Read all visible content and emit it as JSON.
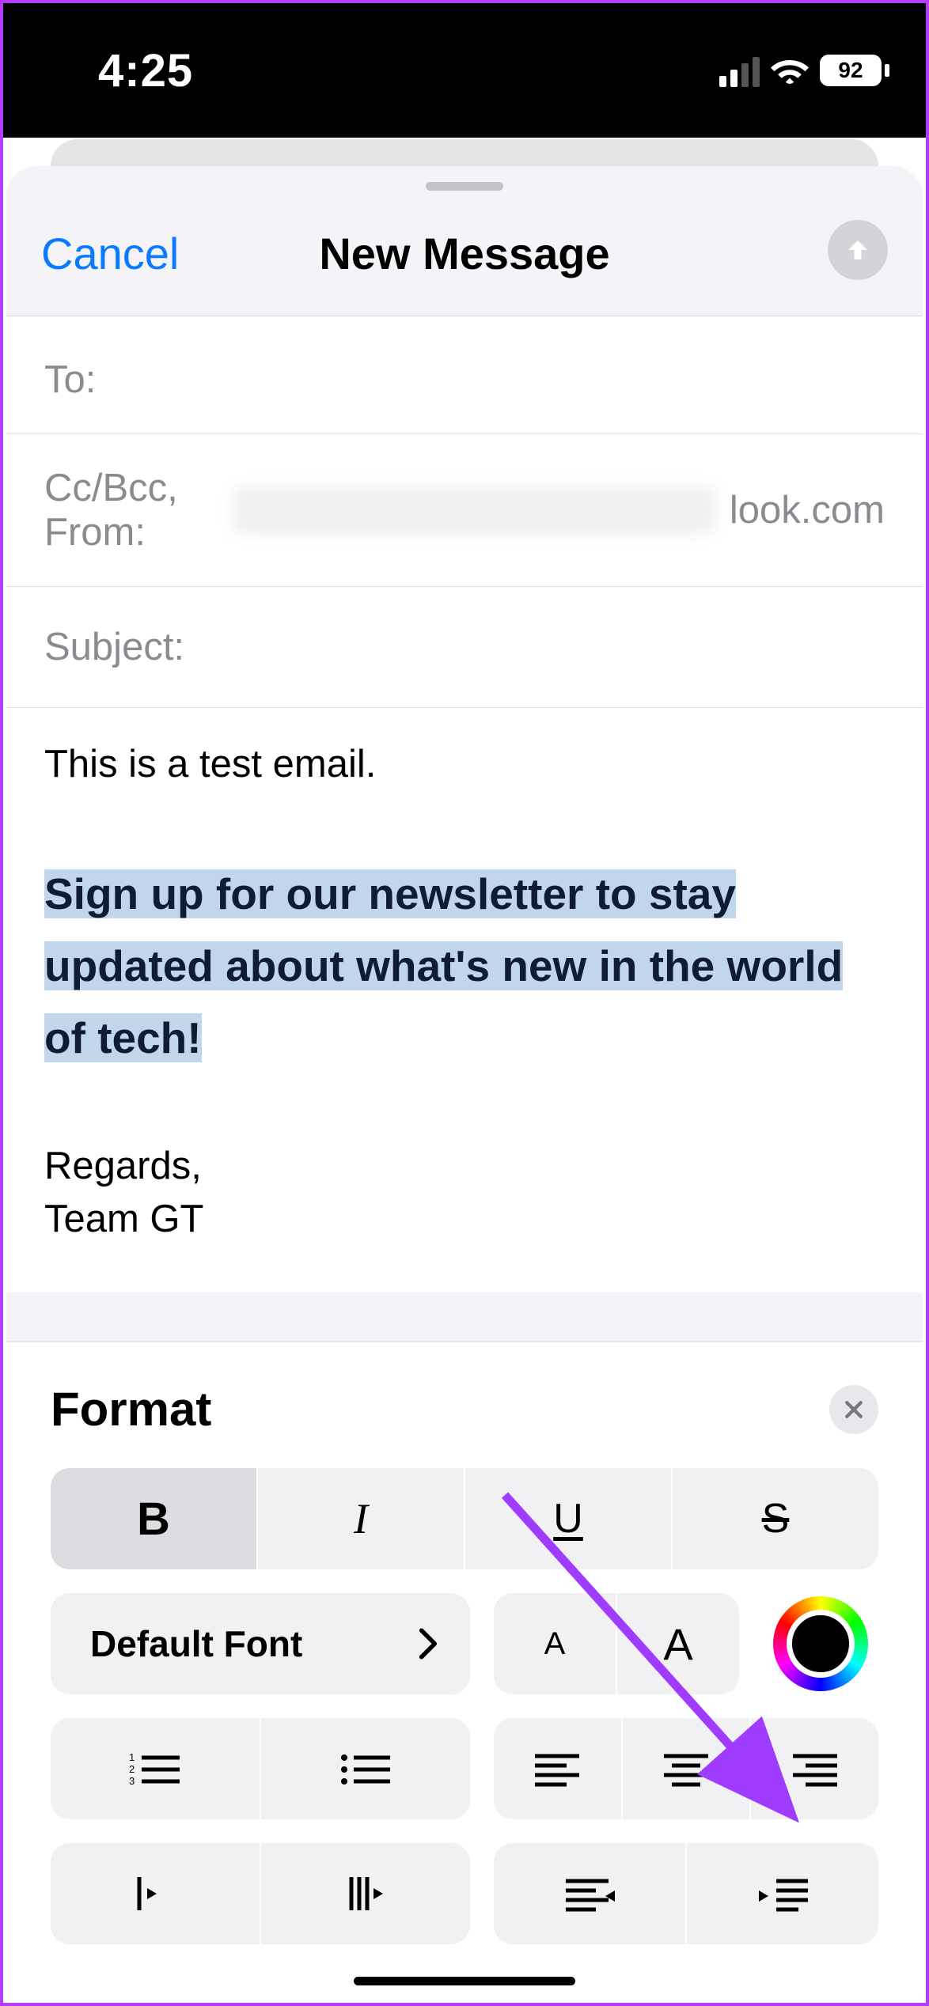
{
  "statusbar": {
    "time": "4:25",
    "battery_pct": "92"
  },
  "header": {
    "cancel": "Cancel",
    "title": "New Message"
  },
  "fields": {
    "to_label": "To:",
    "ccbcc_label": "Cc/Bcc, From:",
    "from_visible_suffix": "look.com",
    "subject_label": "Subject:"
  },
  "body": {
    "line1": "This is a test email.",
    "highlighted": "Sign up for our newsletter to stay updated about what's new in the world of tech!",
    "sig1": "Regards,",
    "sig2": "Team GT"
  },
  "format": {
    "title": "Format",
    "bold": "B",
    "italic": "I",
    "underline": "U",
    "strike": "S",
    "font_label": "Default Font",
    "small_a": "A",
    "big_a": "A"
  }
}
